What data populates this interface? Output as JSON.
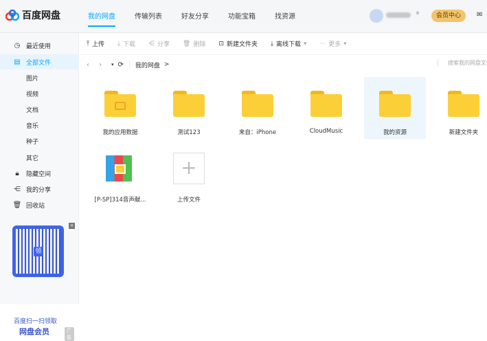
{
  "header": {
    "logo": "百度网盘",
    "tabs": [
      "我的网盘",
      "传输列表",
      "好友分享",
      "功能宝箱",
      "找资源"
    ],
    "active_tab": 0,
    "vip_button": "会员中心"
  },
  "sidebar": {
    "items": [
      {
        "label": "最近使用",
        "icon": "clock-icon"
      },
      {
        "label": "全部文件",
        "icon": "file-icon",
        "selected": true
      },
      {
        "label": "图片",
        "sub": true
      },
      {
        "label": "视频",
        "sub": true
      },
      {
        "label": "文档",
        "sub": true
      },
      {
        "label": "音乐",
        "sub": true
      },
      {
        "label": "种子",
        "sub": true
      },
      {
        "label": "其它",
        "sub": true
      },
      {
        "label": "隐藏空间",
        "icon": "lock-icon"
      },
      {
        "label": "我的分享",
        "icon": "share-icon"
      },
      {
        "label": "回收站",
        "icon": "trash-icon"
      }
    ],
    "promo": {
      "line1": "百度扫一扫领取",
      "line2": "网盘会员",
      "ad": "广告",
      "qr_center": "领"
    }
  },
  "toolbar": {
    "upload": "上传",
    "download": "下载",
    "share": "分享",
    "delete": "删除",
    "new_folder": "新建文件夹",
    "offline": "离线下载",
    "more": "更多"
  },
  "address": {
    "crumb": "我的网盘",
    "sep": ">",
    "search_placeholder": "搜索我的网盘文件"
  },
  "files": [
    {
      "name": "我的应用数据",
      "type": "folder"
    },
    {
      "name": "测试123",
      "type": "folder"
    },
    {
      "name": "来自：iPhone",
      "type": "folder"
    },
    {
      "name": "CloudMusic",
      "type": "folder"
    },
    {
      "name": "我的资源",
      "type": "folder",
      "selected": true
    },
    {
      "name": "新建文件夹",
      "type": "folder"
    },
    {
      "name": "[P-SP]314音声献...",
      "type": "archive"
    },
    {
      "name": "上传文件",
      "type": "upload"
    }
  ],
  "colors": {
    "accent": "#06a7ff",
    "folder": "#fbcf37",
    "vip": "#f2c46b"
  }
}
